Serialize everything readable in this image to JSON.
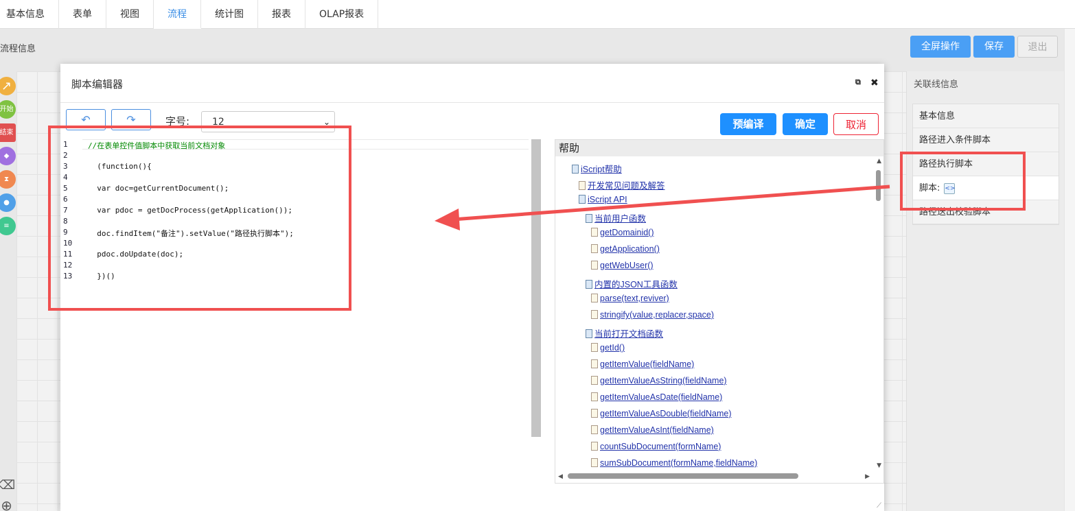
{
  "tabs": [
    {
      "label": "基本信息",
      "active": false
    },
    {
      "label": "表单",
      "active": false
    },
    {
      "label": "视图",
      "active": false
    },
    {
      "label": "流程",
      "active": true
    },
    {
      "label": "统计图",
      "active": false
    },
    {
      "label": "报表",
      "active": false
    },
    {
      "label": "OLAP报表",
      "active": false
    }
  ],
  "toolbar": {
    "title": "流程信息",
    "fullscreen_label": "全屏操作",
    "save_label": "保存",
    "exit_label": "退出"
  },
  "palette": {
    "start_label": "开始",
    "end_label": "结束"
  },
  "right_panel": {
    "title": "关联线信息",
    "items": [
      "基本信息",
      "路径进入条件脚本",
      "路径执行脚本",
      "脚本:",
      "路径送出校验脚本"
    ]
  },
  "modal": {
    "title": "脚本编辑器",
    "font_size_label": "字号:",
    "font_size_value": "12",
    "precompile_label": "预编译",
    "confirm_label": "确定",
    "cancel_label": "取消"
  },
  "editor": {
    "line_numbers": [
      "1",
      "2",
      "3",
      "4",
      "5",
      "6",
      "7",
      "8",
      "9",
      "10",
      "11",
      "12",
      "13"
    ],
    "lines": [
      "//在表单控件值脚本中获取当前文档对象",
      "",
      "  (function(){",
      "",
      "  var doc=getCurrentDocument();",
      "",
      "  var pdoc = getDocProcess(getApplication());",
      "",
      "  doc.findItem(\"备注\").setValue(\"路径执行脚本\");",
      "",
      "  pdoc.doUpdate(doc);",
      "",
      "  })()"
    ]
  },
  "help": {
    "title": "帮助",
    "items": [
      {
        "text": "iScript帮助",
        "type": "folder"
      },
      {
        "text": "开发常见问题及解答",
        "type": "doc"
      },
      {
        "text": "iScript API",
        "type": "folder"
      },
      {
        "text": "当前用户函数",
        "type": "folder"
      },
      {
        "text": "getDomainid()",
        "type": "doc"
      },
      {
        "text": "getApplication()",
        "type": "doc"
      },
      {
        "text": "getWebUser()",
        "type": "doc"
      },
      {
        "text": "内置的JSON工具函数",
        "type": "folder"
      },
      {
        "text": "parse(text,reviver)",
        "type": "doc"
      },
      {
        "text": "stringify(value,replacer,space)",
        "type": "doc"
      },
      {
        "text": "当前打开文档函数",
        "type": "folder"
      },
      {
        "text": "getId()",
        "type": "doc"
      },
      {
        "text": "getItemValue(fieldName)",
        "type": "doc"
      },
      {
        "text": "getItemValueAsString(fieldName)",
        "type": "doc"
      },
      {
        "text": "getItemValueAsDate(fieldName)",
        "type": "doc"
      },
      {
        "text": "getItemValueAsDouble(fieldName)",
        "type": "doc"
      },
      {
        "text": "getItemValueAsInt(fieldName)",
        "type": "doc"
      },
      {
        "text": "countSubDocument(formName)",
        "type": "doc"
      },
      {
        "text": "sumSubDocument(formName,fieldName)",
        "type": "doc"
      }
    ]
  },
  "colors": {
    "accent": "#1e90ff",
    "annotation": "#f05050",
    "cancel": "#ee2233"
  }
}
